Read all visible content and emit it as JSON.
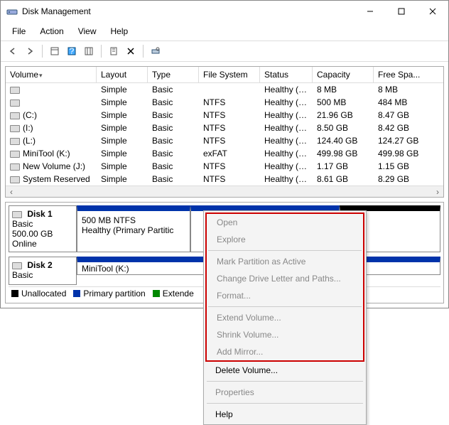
{
  "window": {
    "title": "Disk Management"
  },
  "menu": {
    "file": "File",
    "action": "Action",
    "view": "View",
    "help": "Help"
  },
  "columns": {
    "volume": "Volume",
    "layout": "Layout",
    "type": "Type",
    "fs": "File System",
    "status": "Status",
    "capacity": "Capacity",
    "free": "Free Spa..."
  },
  "rows": [
    {
      "vol": "",
      "layout": "Simple",
      "type": "Basic",
      "fs": "",
      "status": "Healthy (P...",
      "cap": "8 MB",
      "free": "8 MB"
    },
    {
      "vol": "",
      "layout": "Simple",
      "type": "Basic",
      "fs": "NTFS",
      "status": "Healthy (P...",
      "cap": "500 MB",
      "free": "484 MB"
    },
    {
      "vol": "(C:)",
      "layout": "Simple",
      "type": "Basic",
      "fs": "NTFS",
      "status": "Healthy (B...",
      "cap": "21.96 GB",
      "free": "8.47 GB"
    },
    {
      "vol": "(I:)",
      "layout": "Simple",
      "type": "Basic",
      "fs": "NTFS",
      "status": "Healthy (L...",
      "cap": "8.50 GB",
      "free": "8.42 GB"
    },
    {
      "vol": "(L:)",
      "layout": "Simple",
      "type": "Basic",
      "fs": "NTFS",
      "status": "Healthy (P...",
      "cap": "124.40 GB",
      "free": "124.27 GB"
    },
    {
      "vol": "MiniTool (K:)",
      "layout": "Simple",
      "type": "Basic",
      "fs": "exFAT",
      "status": "Healthy (P...",
      "cap": "499.98 GB",
      "free": "499.98 GB"
    },
    {
      "vol": "New Volume (J:)",
      "layout": "Simple",
      "type": "Basic",
      "fs": "NTFS",
      "status": "Healthy (P...",
      "cap": "1.17 GB",
      "free": "1.15 GB"
    },
    {
      "vol": "System Reserved",
      "layout": "Simple",
      "type": "Basic",
      "fs": "NTFS",
      "status": "Healthy (S...",
      "cap": "8.61 GB",
      "free": "8.29 GB"
    }
  ],
  "disk1": {
    "name": "Disk 1",
    "type": "Basic",
    "size": "500.00 GB",
    "state": "Online",
    "part1_line1": "500 MB NTFS",
    "part1_line2": "Healthy (Primary Partitic"
  },
  "disk2": {
    "name": "Disk 2",
    "type": "Basic",
    "part1": "MiniTool (K:)"
  },
  "legend": {
    "unalloc": "Unallocated",
    "primary": "Primary partition",
    "ext": "Extende"
  },
  "ctx": {
    "open": "Open",
    "explore": "Explore",
    "mark": "Mark Partition as Active",
    "change": "Change Drive Letter and Paths...",
    "format": "Format...",
    "extend": "Extend Volume...",
    "shrink": "Shrink Volume...",
    "mirror": "Add Mirror...",
    "delete": "Delete Volume...",
    "props": "Properties",
    "help": "Help"
  }
}
